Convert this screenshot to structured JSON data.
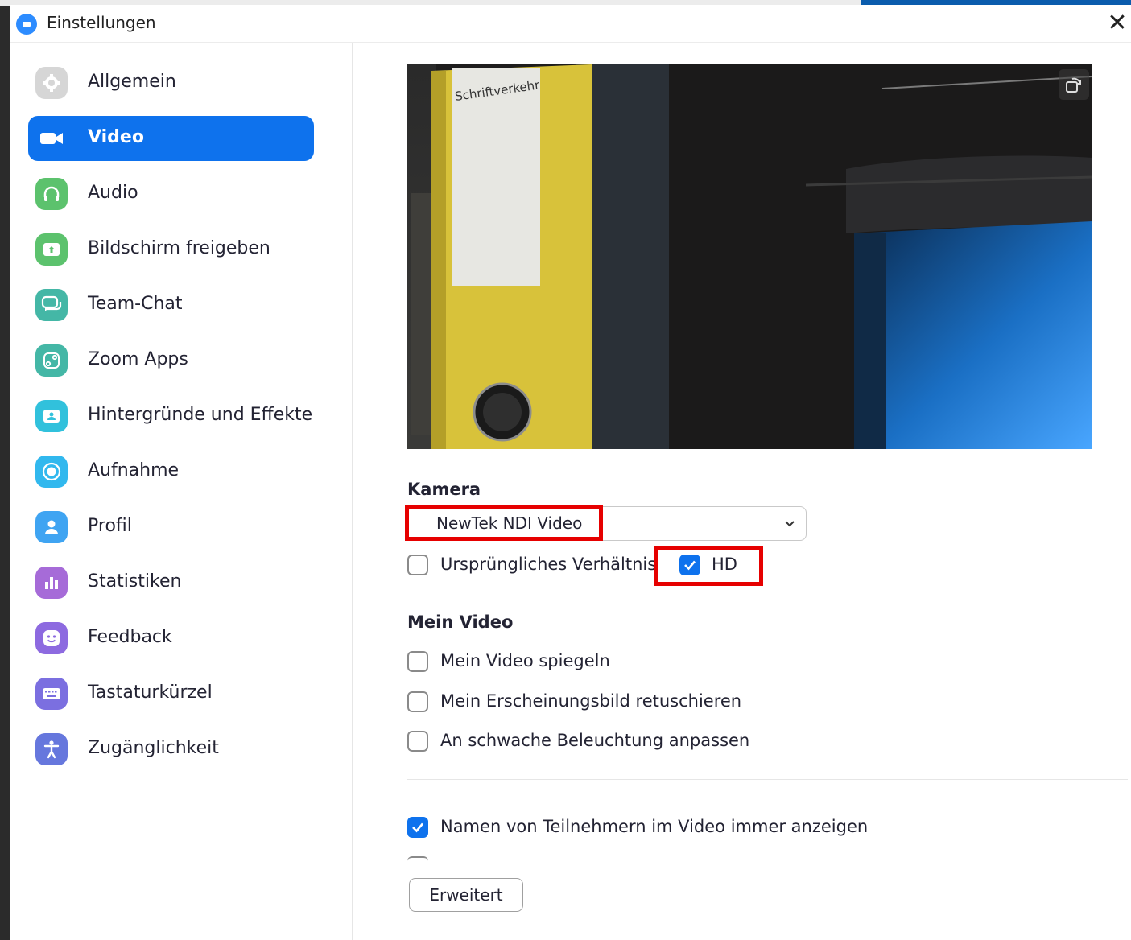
{
  "window": {
    "title": "Einstellungen"
  },
  "sidebar": {
    "items": [
      {
        "label": "Allgemein",
        "icon": "gear-icon",
        "color": "#d3d3d3"
      },
      {
        "label": "Video",
        "icon": "video-camera-icon",
        "color": "#0e72ed",
        "active": true
      },
      {
        "label": "Audio",
        "icon": "headphones-icon",
        "color": "#5cc26d"
      },
      {
        "label": "Bildschirm freigeben",
        "icon": "share-screen-icon",
        "color": "#5cc26d"
      },
      {
        "label": "Team-Chat",
        "icon": "chat-icon",
        "color": "#44b7a6"
      },
      {
        "label": "Zoom Apps",
        "icon": "apps-icon",
        "color": "#44b7a6"
      },
      {
        "label": "Hintergründe und Effekte",
        "icon": "background-icon",
        "color": "#31c1dc"
      },
      {
        "label": "Aufnahme",
        "icon": "record-icon",
        "color": "#31b8ee"
      },
      {
        "label": "Profil",
        "icon": "profile-icon",
        "color": "#3fa4f2"
      },
      {
        "label": "Statistiken",
        "icon": "statistics-icon",
        "color": "#a66bd8"
      },
      {
        "label": "Feedback",
        "icon": "feedback-icon",
        "color": "#8d6ae0"
      },
      {
        "label": "Tastaturkürzel",
        "icon": "keyboard-icon",
        "color": "#7b6fe0"
      },
      {
        "label": "Zugänglichkeit",
        "icon": "accessibility-icon",
        "color": "#6677dd"
      }
    ]
  },
  "preview": {
    "binder_label": "Schriftverkehr"
  },
  "camera": {
    "section_title": "Kamera",
    "selected": "NewTek NDI Video",
    "original_ratio_label": "Ursprüngliches Verhältnis",
    "original_ratio_checked": false,
    "hd_label": "HD",
    "hd_checked": true
  },
  "my_video": {
    "section_title": "Mein Video",
    "mirror_label": "Mein Video spiegeln",
    "mirror_checked": false,
    "touch_up_label": "Mein Erscheinungsbild retuschieren",
    "touch_up_checked": false,
    "low_light_label": "An schwache Beleuchtung anpassen",
    "low_light_checked": false
  },
  "names": {
    "label": "Namen von Teilnehmern im Video immer anzeigen",
    "checked": true
  },
  "advanced_button": "Erweitert",
  "colors": {
    "accent": "#0e72ed",
    "highlight": "#e60000"
  }
}
